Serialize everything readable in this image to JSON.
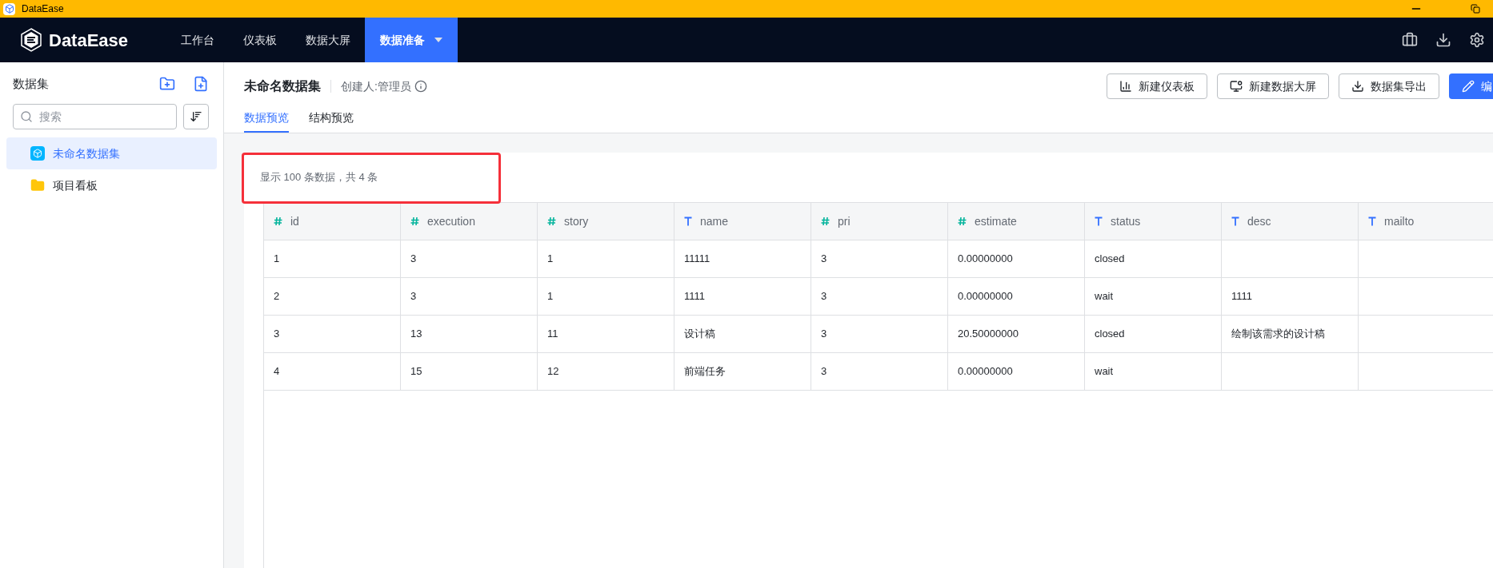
{
  "window": {
    "title": "DataEase"
  },
  "nav": {
    "logo": "DataEase",
    "items": [
      {
        "label": "工作台",
        "selected": false
      },
      {
        "label": "仪表板",
        "selected": false
      },
      {
        "label": "数据大屏",
        "selected": false
      },
      {
        "label": "数据准备",
        "selected": true
      }
    ]
  },
  "sidebar": {
    "title": "数据集",
    "search": {
      "placeholder": "搜索"
    },
    "items": [
      {
        "label": "未命名数据集",
        "kind": "dataset",
        "selected": true
      },
      {
        "label": "项目看板",
        "kind": "folder",
        "selected": false
      }
    ]
  },
  "header": {
    "title": "未命名数据集",
    "creator": "创建人:管理员",
    "buttons": [
      {
        "label": "新建仪表板",
        "kind": "chart"
      },
      {
        "label": "新建数据大屏",
        "kind": "screen"
      },
      {
        "label": "数据集导出",
        "kind": "download"
      },
      {
        "label": "编",
        "kind": "edit"
      }
    ],
    "tabs": [
      {
        "label": "数据预览",
        "selected": true
      },
      {
        "label": "结构预览",
        "selected": false
      }
    ]
  },
  "summary": "显示 100 条数据，共 4 条",
  "table": {
    "columns": [
      {
        "name": "id",
        "kind": "number"
      },
      {
        "name": "execution",
        "kind": "number"
      },
      {
        "name": "story",
        "kind": "number"
      },
      {
        "name": "name",
        "kind": "text"
      },
      {
        "name": "pri",
        "kind": "number"
      },
      {
        "name": "estimate",
        "kind": "number"
      },
      {
        "name": "status",
        "kind": "text"
      },
      {
        "name": "desc",
        "kind": "text"
      },
      {
        "name": "mailto",
        "kind": "text"
      }
    ],
    "rows": [
      [
        "1",
        "3",
        "1",
        "11111",
        "3",
        "0.00000000",
        "closed",
        null,
        null
      ],
      [
        "2",
        "3",
        "1",
        "1111",
        "3",
        "0.00000000",
        "wait",
        "1111",
        null
      ],
      [
        "3",
        "13",
        "11",
        "设计稿",
        "3",
        "20.50000000",
        "closed",
        "绘制该需求的设计稿",
        null
      ],
      [
        "4",
        "15",
        "12",
        "前端任务",
        "3",
        "0.00000000",
        "wait",
        null,
        null
      ]
    ]
  }
}
